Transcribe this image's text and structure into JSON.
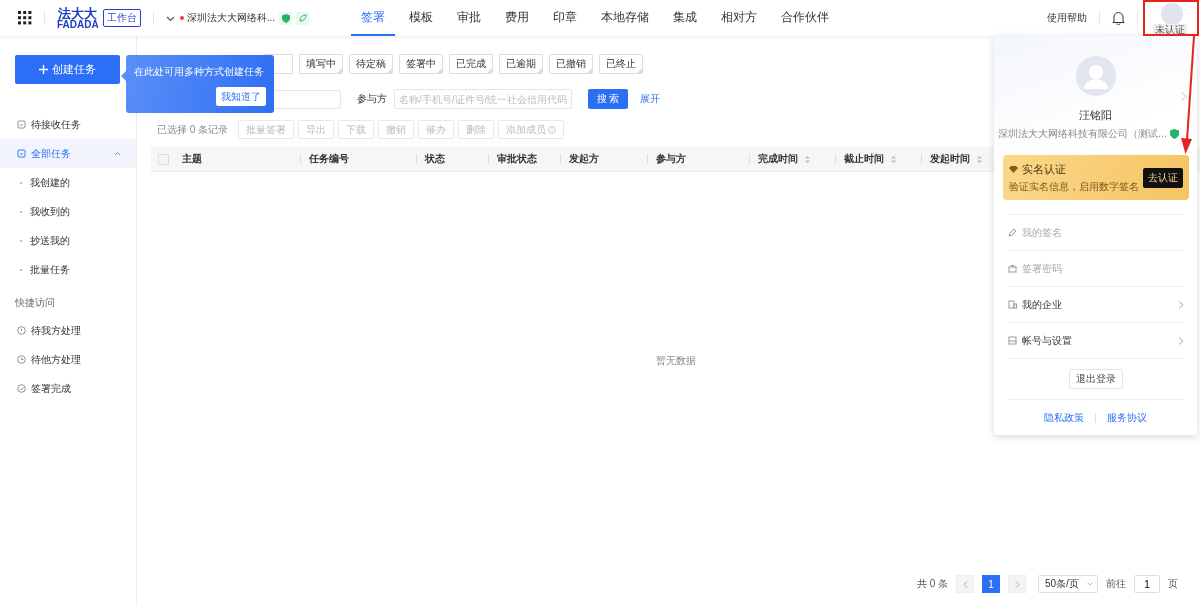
{
  "header": {
    "logo": {
      "text": "法大大",
      "subtext": "FADADA",
      "badge": "工作台"
    },
    "company": {
      "name": "深圳法大大网络科...",
      "alert": true
    },
    "nav": [
      {
        "label": "签署",
        "selected": true
      },
      {
        "label": "模板",
        "selected": false
      },
      {
        "label": "审批",
        "selected": false
      },
      {
        "label": "费用",
        "selected": false
      },
      {
        "label": "印章",
        "selected": false
      },
      {
        "label": "本地存储",
        "selected": false
      },
      {
        "label": "集成",
        "selected": false
      },
      {
        "label": "相对方",
        "selected": false
      },
      {
        "label": "合作伙伴",
        "selected": false
      }
    ],
    "help": "使用帮助",
    "avatar_badge": "未认证"
  },
  "sidebar": {
    "create_button": "创建任务",
    "items": [
      {
        "label": "待接收任务",
        "selected": false
      },
      {
        "label": "全部任务",
        "selected": true,
        "expanded": true,
        "children": [
          {
            "label": "我创建的"
          },
          {
            "label": "我收到的"
          },
          {
            "label": "抄送我的"
          },
          {
            "label": "批量任务"
          }
        ]
      }
    ],
    "section_title": "快捷访问",
    "quick": [
      {
        "label": "待我方处理",
        "kind": "pending"
      },
      {
        "label": "待他方处理",
        "kind": "waiting"
      },
      {
        "label": "签署完成",
        "kind": "done"
      }
    ]
  },
  "tooltip": {
    "text": "在此处可用多种方式创建任务",
    "button": "我知道了"
  },
  "filters": [
    {
      "label": "填写中",
      "selected": false
    },
    {
      "label": "待定稿",
      "selected": false
    },
    {
      "label": "签署中",
      "selected": false
    },
    {
      "label": "已完成",
      "selected": false
    },
    {
      "label": "已逾期",
      "selected": false
    },
    {
      "label": "已撤销",
      "selected": false
    },
    {
      "label": "已终止",
      "selected": false
    }
  ],
  "search": {
    "participant_label": "参与方",
    "participant_placeholder": "名称/手机号/证件号/统一社会信用代码",
    "button": "搜 索",
    "expand": "展开"
  },
  "toolbar": {
    "selection": "已选择 0 条记录",
    "actions": [
      {
        "label": "批量签署",
        "disabled": true
      },
      {
        "label": "导出",
        "disabled": true
      },
      {
        "label": "下载",
        "disabled": true
      },
      {
        "label": "撤销",
        "disabled": true
      },
      {
        "label": "催办",
        "disabled": true
      },
      {
        "label": "删除",
        "disabled": true
      },
      {
        "label": "添加成员",
        "disabled": true,
        "info": true
      }
    ]
  },
  "table": {
    "select_all_checked": false,
    "columns": [
      {
        "label": "主题",
        "sortable": false
      },
      {
        "label": "任务编号",
        "sortable": false
      },
      {
        "label": "状态",
        "sortable": false
      },
      {
        "label": "审批状态",
        "sortable": false
      },
      {
        "label": "发起方",
        "sortable": false
      },
      {
        "label": "参与方",
        "sortable": false
      },
      {
        "label": "完成时间",
        "sortable": true
      },
      {
        "label": "截止时间",
        "sortable": true
      },
      {
        "label": "发起时间",
        "sortable": true
      }
    ],
    "empty": "暂无数据"
  },
  "pagination": {
    "total": "共 0 条",
    "pages": [
      {
        "label": "1",
        "selected": true
      }
    ],
    "page_size": "50条/页",
    "goto_label": "前往",
    "goto_value": "1",
    "goto_suffix": "页"
  },
  "user_panel": {
    "name": "汪铭阳",
    "company": "深圳法大大网络科技有限公司（测试...",
    "verify": {
      "title": "实名认证",
      "subtitle": "验证实名信息，启用数字签名",
      "button": "去认证"
    },
    "menu": [
      {
        "label": "我的签名",
        "kind": "pen",
        "disabled": true,
        "chevron": false
      },
      {
        "label": "签署密码",
        "kind": "lock",
        "disabled": true,
        "chevron": false
      },
      {
        "label": "我的企业",
        "kind": "building",
        "disabled": false,
        "chevron": true
      },
      {
        "label": "帐号与设置",
        "kind": "settings",
        "disabled": false,
        "chevron": true
      }
    ],
    "logout": "退出登录",
    "links": [
      "隐私政策",
      "服务协议"
    ]
  }
}
